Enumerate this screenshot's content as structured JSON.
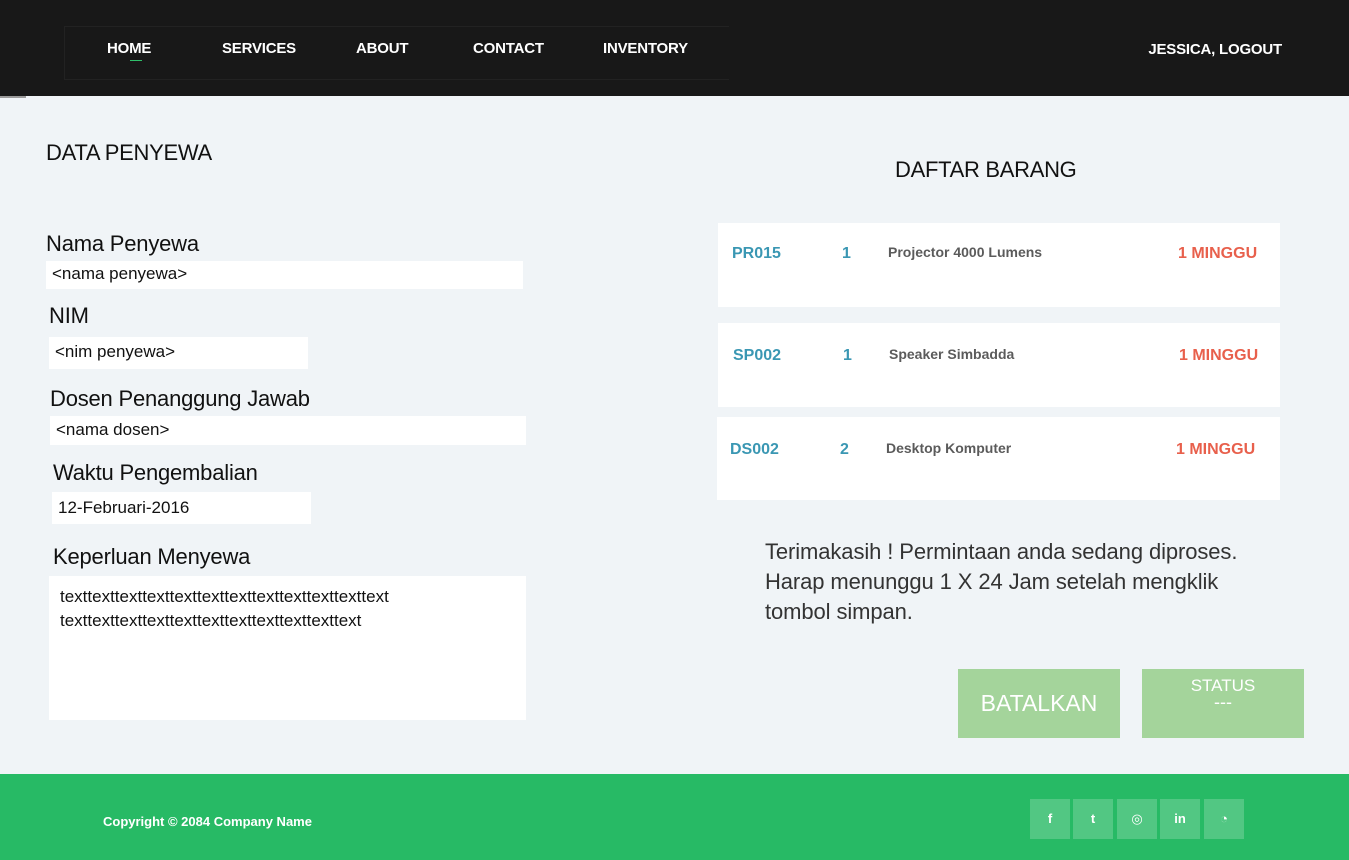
{
  "nav": {
    "items": [
      "HOME",
      "SERVICES",
      "ABOUT",
      "CONTACT",
      "INVENTORY"
    ],
    "user": "JESSICA, LOGOUT"
  },
  "form": {
    "title": "DATA PENYEWA",
    "name_label": "Nama Penyewa",
    "name_value": "<nama penyewa>",
    "nim_label": "NIM",
    "nim_value": "<nim penyewa>",
    "lecturer_label": "Dosen Penanggung Jawab",
    "lecturer_value": "<nama dosen>",
    "return_label": "Waktu Pengembalian",
    "return_value": "12-Februari-2016",
    "purpose_label": "Keperluan Menyewa",
    "purpose_line1": "texttexttexttexttexttexttexttexttexttexttexttext",
    "purpose_line2": "texttexttexttexttexttexttexttexttexttexttext"
  },
  "items": {
    "title": "DAFTAR BARANG",
    "list": [
      {
        "code": "PR015",
        "qty": "1",
        "name": "Projector 4000 Lumens",
        "duration": "1 MINGGU"
      },
      {
        "code": "SP002",
        "qty": "1",
        "name": "Speaker Simbadda",
        "duration": "1 MINGGU"
      },
      {
        "code": "DS002",
        "qty": "2",
        "name": "Desktop Komputer",
        "duration": "1 MINGGU"
      }
    ]
  },
  "message": {
    "line1": "Terimakasih ! Permintaan anda sedang diproses.",
    "line2": "Harap menunggu 1 X 24 Jam setelah mengklik",
    "line3": "tombol simpan."
  },
  "buttons": {
    "cancel": "BATALKAN",
    "status_label": "STATUS",
    "status_value": "---"
  },
  "footer": {
    "copyright": "Copyright © 2084 Company Name",
    "social_icons": [
      "facebook-icon",
      "twitter-icon",
      "instagram-icon",
      "linkedin-icon",
      "rss-icon"
    ],
    "social_glyphs": [
      "f",
      "t",
      "◎",
      "in",
      "◔"
    ]
  },
  "colors": {
    "header_bg": "#181818",
    "footer_bg": "#27ba65",
    "item_code": "#3a97b3",
    "item_duration": "#e8604c",
    "button_bg": "#a4d49b"
  }
}
